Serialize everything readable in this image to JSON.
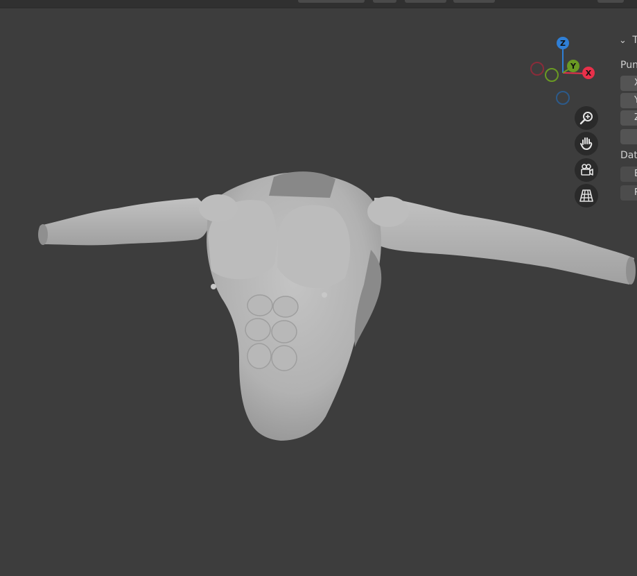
{
  "gizmo": {
    "z_label": "Z",
    "y_label": "Y",
    "x_label": "X",
    "colors": {
      "x": "#e8304a",
      "y": "#6a9a23",
      "z": "#2f7fd6",
      "neg_x": "#8a2c3a",
      "neg_y": "#4a6a2a",
      "neg_z": "#2c5a8a"
    }
  },
  "nav_buttons": {
    "zoom": "zoom-icon",
    "pan": "hand-icon",
    "camera": "camera-icon",
    "perspective": "grid-icon"
  },
  "n_panel": {
    "section_title": "T",
    "section_chevron": "⌄",
    "group1_label": "Pun",
    "fields": [
      "X",
      "Y",
      "Z",
      ""
    ],
    "group2_label": "Dat",
    "buttons": [
      "B",
      "R"
    ]
  },
  "colors": {
    "viewport_bg": "#3d3d3d",
    "mesh": "#b4b4b4"
  }
}
